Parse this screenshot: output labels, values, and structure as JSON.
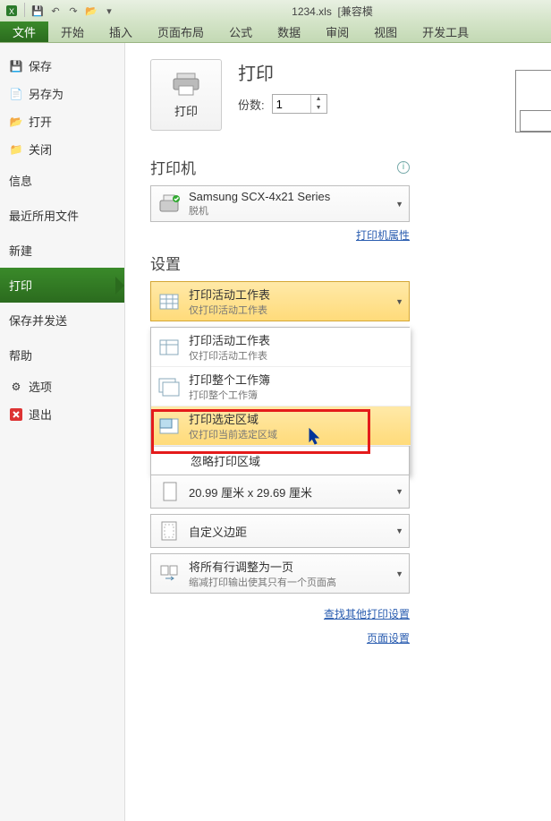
{
  "titlebar": {
    "filename": "1234.xls",
    "mode": "[兼容模"
  },
  "ribbon": {
    "file": "文件",
    "tabs": [
      "开始",
      "插入",
      "页面布局",
      "公式",
      "数据",
      "审阅",
      "视图",
      "开发工具"
    ]
  },
  "nav": {
    "save": "保存",
    "saveas": "另存为",
    "open": "打开",
    "close": "关闭",
    "info": "信息",
    "recent": "最近所用文件",
    "new": "新建",
    "print": "打印",
    "share": "保存并发送",
    "help": "帮助",
    "options": "选项",
    "exit": "退出"
  },
  "content": {
    "print_btn": "打印",
    "print_title": "打印",
    "copies_label": "份数:",
    "copies_value": "1",
    "printer_section": "打印机",
    "printer_name": "Samsung SCX-4x21 Series",
    "printer_status": "脱机",
    "printer_props": "打印机属性",
    "settings_section": "设置",
    "what_selected_title": "打印活动工作表",
    "what_selected_sub": "仅打印活动工作表",
    "popup_opt1_title": "打印活动工作表",
    "popup_opt1_sub": "仅打印活动工作表",
    "popup_opt2_title": "打印整个工作簿",
    "popup_opt2_sub": "打印整个工作簿",
    "popup_opt3_title": "打印选定区域",
    "popup_opt3_sub": "仅打印当前选定区域",
    "popup_ignore": "忽略打印区域",
    "paper": "20.99 厘米 x 29.69 厘米",
    "margins": "自定义边距",
    "scaling_title": "将所有行调整为一页",
    "scaling_sub": "缩减打印输出使其只有一个页面高",
    "other_link": "查找其他打印设置",
    "page_setup": "页面设置"
  }
}
